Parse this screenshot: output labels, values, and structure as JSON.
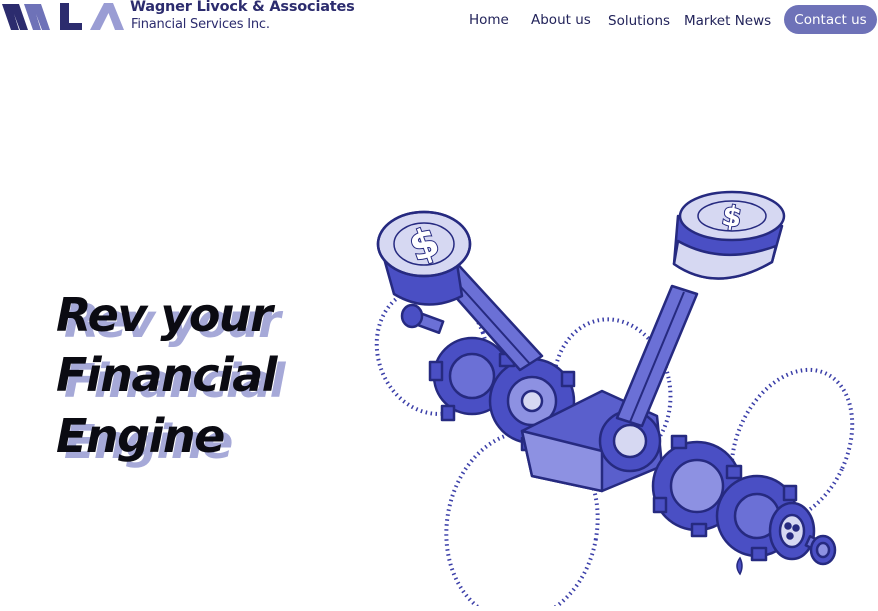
{
  "brand": {
    "logo_text": "WLA",
    "name": "Wagner Livock & Associates",
    "subtitle": "Financial Services Inc."
  },
  "nav": {
    "items": [
      {
        "label": "Home"
      },
      {
        "label": "About us"
      },
      {
        "label": "Solutions"
      },
      {
        "label": "Market News"
      }
    ],
    "cta": "Contact us"
  },
  "hero": {
    "lines": [
      "Rev your",
      "Financial",
      "Engine"
    ]
  },
  "illustration": {
    "subject": "engine-crankshaft-with-dollar-pistons",
    "piston_symbol": "$"
  },
  "colors": {
    "brand_navy": "#2c2c6e",
    "accent": "#6e72b8",
    "illustration_blue": "#4a4fc4",
    "illustration_light": "#d6d8f2",
    "hero_shadow": "#a6a9d8",
    "hero_text": "#0b0b12"
  }
}
